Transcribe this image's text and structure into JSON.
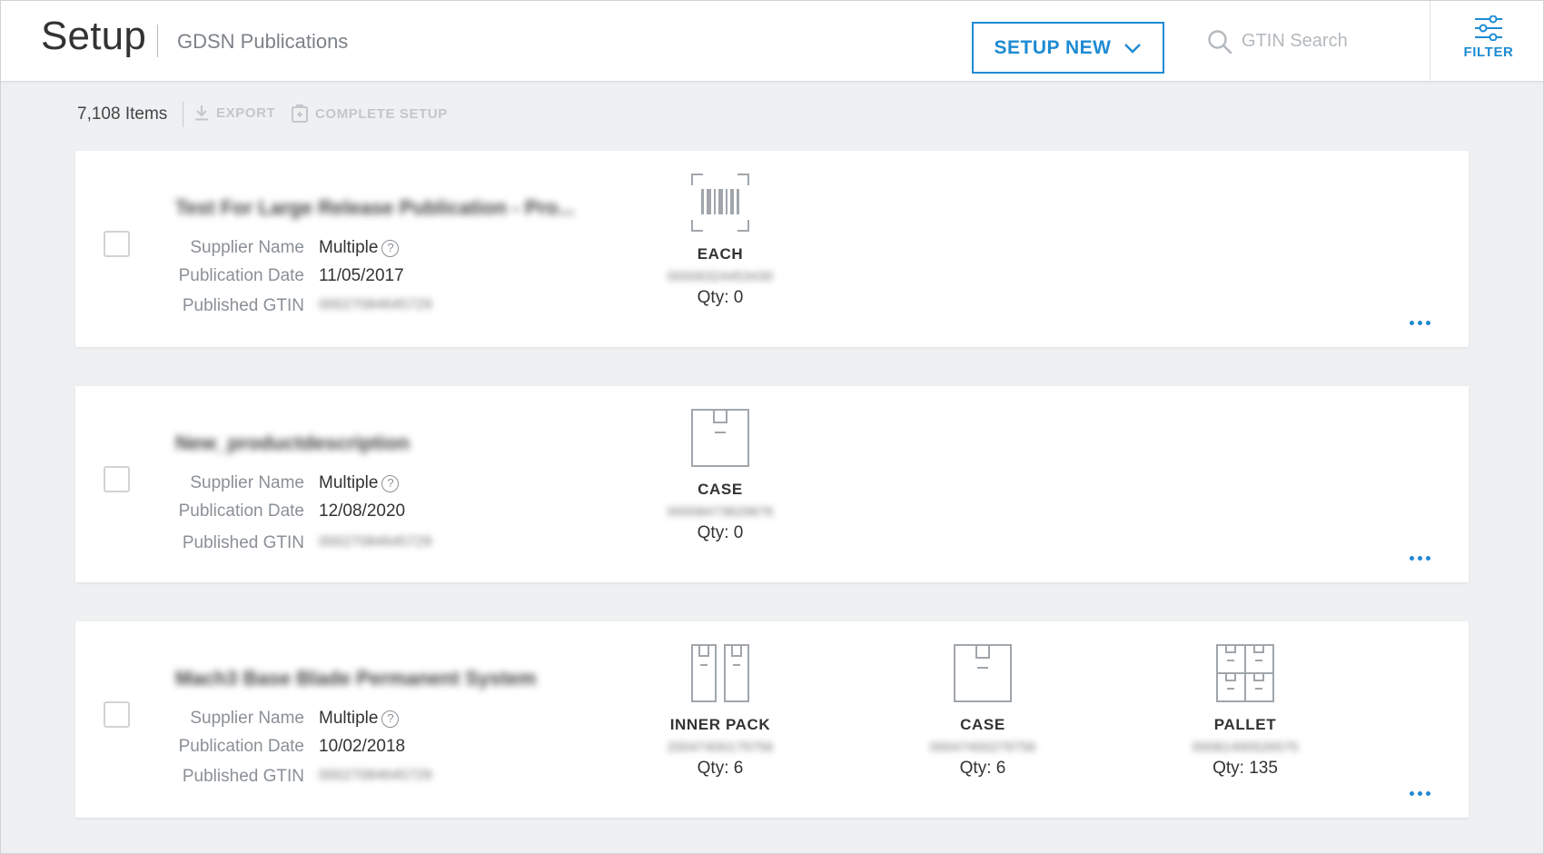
{
  "header": {
    "title": "Setup",
    "subtitle": "GDSN Publications",
    "setup_new_label": "SETUP NEW",
    "search_placeholder": "GTIN Search",
    "filter_label": "FILTER"
  },
  "toolbar": {
    "item_count": "7,108 Items",
    "export_label": "EXPORT",
    "complete_setup_label": "COMPLETE SETUP"
  },
  "labels": {
    "supplier_name": "Supplier Name",
    "publication_date": "Publication Date",
    "published_gtin": "Published GTIN"
  },
  "colors": {
    "accent": "#1e8bd3",
    "background": "#eef0f2",
    "muted_text": "#8a9096"
  },
  "items": [
    {
      "name": "Test For Large Release Publication - Pro...",
      "supplier": "Multiple",
      "publication_date": "11/05/2017",
      "published_gtin": "00027084645729",
      "packages": [
        {
          "icon": "barcode-icon",
          "type": "EACH",
          "gtin": "00006324453430",
          "qty": "Qty: 0"
        }
      ]
    },
    {
      "name": "New_productdescription",
      "supplier": "Multiple",
      "publication_date": "12/08/2020",
      "published_gtin": "00027084645729",
      "packages": [
        {
          "icon": "case-box-icon",
          "type": "CASE",
          "gtin": "00008473829876",
          "qty": "Qty: 0"
        }
      ]
    },
    {
      "name": "Mach3 Base Blade Permanent System",
      "supplier": "Multiple",
      "publication_date": "10/02/2018",
      "published_gtin": "00027084645729",
      "packages": [
        {
          "icon": "inner-pack-icon",
          "type": "INNER PACK",
          "gtin": "20047400179756",
          "qty": "Qty: 6"
        },
        {
          "icon": "case-box-icon",
          "type": "CASE",
          "gtin": "00047400279756",
          "qty": "Qty: 6"
        },
        {
          "icon": "pallet-icon",
          "type": "PALLET",
          "gtin": "00081490526575",
          "qty": "Qty: 135"
        }
      ]
    }
  ]
}
